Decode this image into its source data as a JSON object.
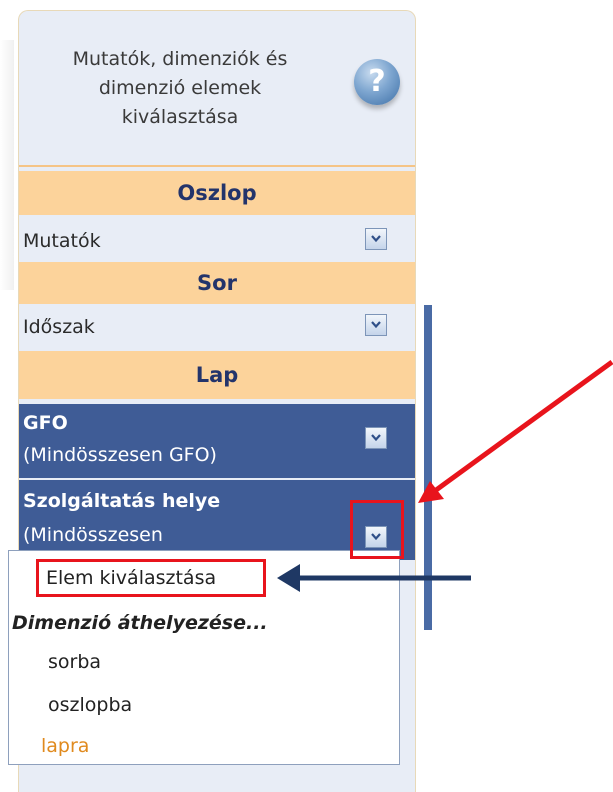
{
  "header": {
    "title": "Mutatók, dimenziók és dimenzió elemek kiválasztása",
    "help_icon": "?"
  },
  "sections": {
    "column": {
      "title": "Oszlop",
      "field": "Mutatók"
    },
    "row": {
      "title": "Sor",
      "field": "Időszak"
    },
    "page": {
      "title": "Lap"
    }
  },
  "page_dims": [
    {
      "name": "GFO",
      "value": "(Mindösszesen GFO)"
    },
    {
      "name": "Szolgáltatás helye",
      "value": "(Mindösszesen"
    }
  ],
  "menu": {
    "select_item": "Elem kiválasztása",
    "move_heading": "Dimenzió áthelyezése...",
    "to_row": "sorba",
    "to_column": "oszlopba",
    "to_page": "lapra"
  },
  "colors": {
    "section_bg": "#fcd39b",
    "selected_bg": "#3f5c96",
    "highlight": "#e8141c",
    "arrow": "#1f3864",
    "active_text": "#e08a1e"
  }
}
